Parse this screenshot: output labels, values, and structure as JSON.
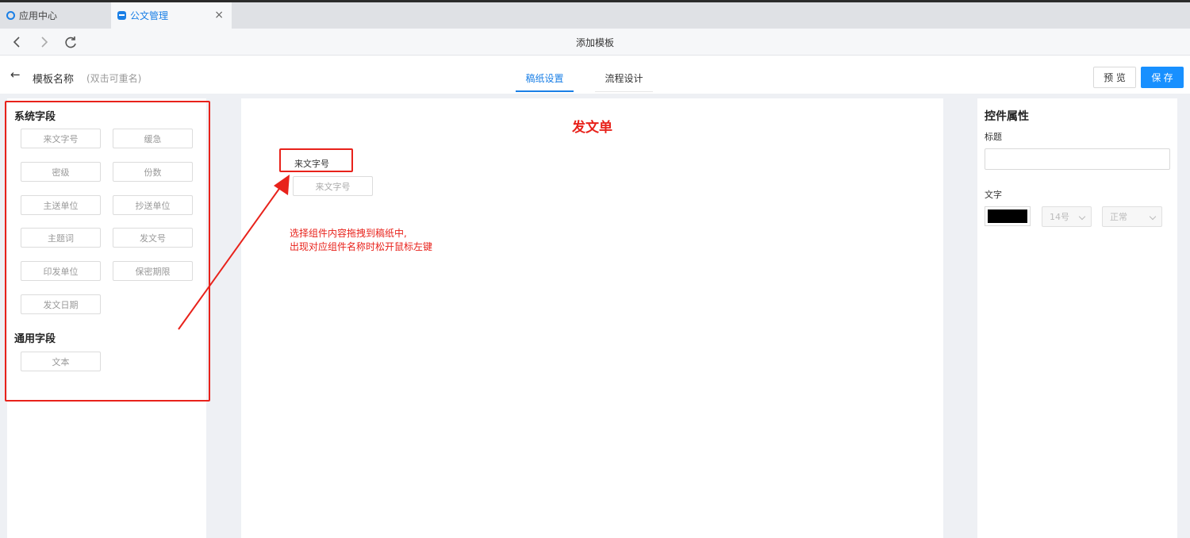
{
  "browser": {
    "tabs": [
      {
        "label": "应用中心"
      },
      {
        "label": "公文管理"
      }
    ],
    "close_symbol": "×",
    "page_title": "添加模板",
    "nav_icons": {
      "back": "chevron-left-icon",
      "forward": "chevron-right-icon",
      "reload": "reload-icon"
    }
  },
  "header": {
    "back_symbol": "←",
    "template_name": "模板名称",
    "rename_hint": "(双击可重名)",
    "tabs": [
      {
        "label": "稿纸设置",
        "active": true
      },
      {
        "label": "流程设计",
        "active": false
      }
    ],
    "preview_label": "预 览",
    "save_label": "保 存"
  },
  "left_panel": {
    "system_group_title": "系统字段",
    "system_fields": [
      "来文字号",
      "缓急",
      "密级",
      "份数",
      "主送单位",
      "抄送单位",
      "主题词",
      "发文号",
      "印发单位",
      "保密期限",
      "发文日期"
    ],
    "common_group_title": "通用字段",
    "common_fields": [
      "文本"
    ]
  },
  "canvas": {
    "doc_title": "发文单",
    "placed_field_label": "来文字号",
    "drag_ghost_label": "来文字号",
    "annotation_lines": [
      "选择组件内容拖拽到稿纸中,",
      "出现对应组件名称时松开鼠标左键"
    ]
  },
  "right_panel": {
    "title": "控件属性",
    "title_label": "标题",
    "title_value": "",
    "text_label": "文字",
    "text_color": "#000000",
    "font_size": "14号",
    "font_weight": "正常"
  },
  "colors": {
    "accent": "#1890ff",
    "annotation_red": "#e8221b"
  }
}
